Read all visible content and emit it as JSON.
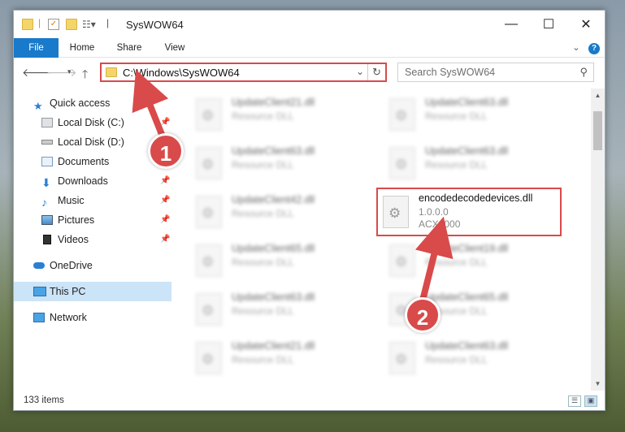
{
  "window": {
    "title": "SysWOW64"
  },
  "ribbon": {
    "tabs": [
      "File",
      "Home",
      "Share",
      "View"
    ]
  },
  "address": {
    "path": "C:\\Windows\\SysWOW64",
    "search_placeholder": "Search SysWOW64"
  },
  "sidebar": {
    "items": [
      {
        "label": "Quick access",
        "icon": "star-icon"
      },
      {
        "label": "Local Disk (C:)",
        "icon": "drive-icon"
      },
      {
        "label": "Local Disk (D:)",
        "icon": "drive-icon"
      },
      {
        "label": "Documents",
        "icon": "documents-icon"
      },
      {
        "label": "Downloads",
        "icon": "downloads-icon"
      },
      {
        "label": "Music",
        "icon": "music-icon"
      },
      {
        "label": "Pictures",
        "icon": "pictures-icon"
      },
      {
        "label": "Videos",
        "icon": "videos-icon"
      },
      {
        "label": "OneDrive",
        "icon": "cloud-icon"
      },
      {
        "label": "This PC",
        "icon": "computer-icon"
      },
      {
        "label": "Network",
        "icon": "network-icon"
      }
    ]
  },
  "files": {
    "left": [
      {
        "name": "UpdateClient21.dll",
        "type": "Resource DLL"
      },
      {
        "name": "UpdateClient63.dll",
        "type": "Resource DLL"
      },
      {
        "name": "UpdateClient42.dll",
        "type": "Resource DLL"
      },
      {
        "name": "UpdateClient65.dll",
        "type": "Resource DLL"
      },
      {
        "name": "UpdateClient63.dll",
        "type": "Resource DLL"
      },
      {
        "name": "UpdateClient21.dll",
        "type": "Resource DLL"
      }
    ],
    "right": [
      {
        "name": "UpdateClient63.dll",
        "type": "Resource DLL"
      },
      {
        "name": "UpdateClient63.dll",
        "type": "Resource DLL"
      },
      {
        "name": "encodedecodedevices.dll",
        "version": "1.0.0.0",
        "company": "ACX2000"
      },
      {
        "name": "UpdateClient19.dll",
        "type": "Resource DLL"
      },
      {
        "name": "UpdateClient65.dll",
        "type": "Resource DLL"
      },
      {
        "name": "UpdateClient63.dll",
        "type": "Resource DLL"
      }
    ]
  },
  "status": {
    "count": "133 items"
  },
  "annotations": {
    "step1": "1",
    "step2": "2",
    "color": "#d94a4a"
  }
}
